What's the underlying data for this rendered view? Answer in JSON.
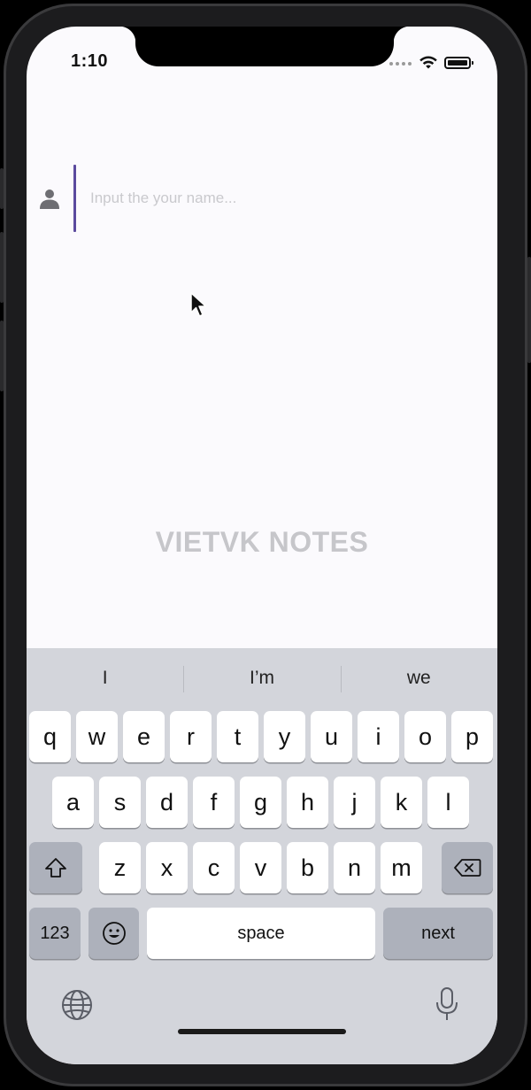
{
  "status_bar": {
    "time": "1:10"
  },
  "form": {
    "name_placeholder": "Input the your name..."
  },
  "brand": {
    "title": "VIETVK NOTES"
  },
  "keyboard": {
    "suggestions": [
      "I",
      "I’m",
      "we"
    ],
    "row1": [
      "q",
      "w",
      "e",
      "r",
      "t",
      "y",
      "u",
      "i",
      "o",
      "p"
    ],
    "row2": [
      "a",
      "s",
      "d",
      "f",
      "g",
      "h",
      "j",
      "k",
      "l"
    ],
    "row3": [
      "z",
      "x",
      "c",
      "v",
      "b",
      "n",
      "m"
    ],
    "numbers_label": "123",
    "space_label": "space",
    "return_label": "next"
  },
  "colors": {
    "accent": "#5b4a9e",
    "brand_text": "#c6c6ca",
    "keyboard_bg": "#d3d5db"
  }
}
